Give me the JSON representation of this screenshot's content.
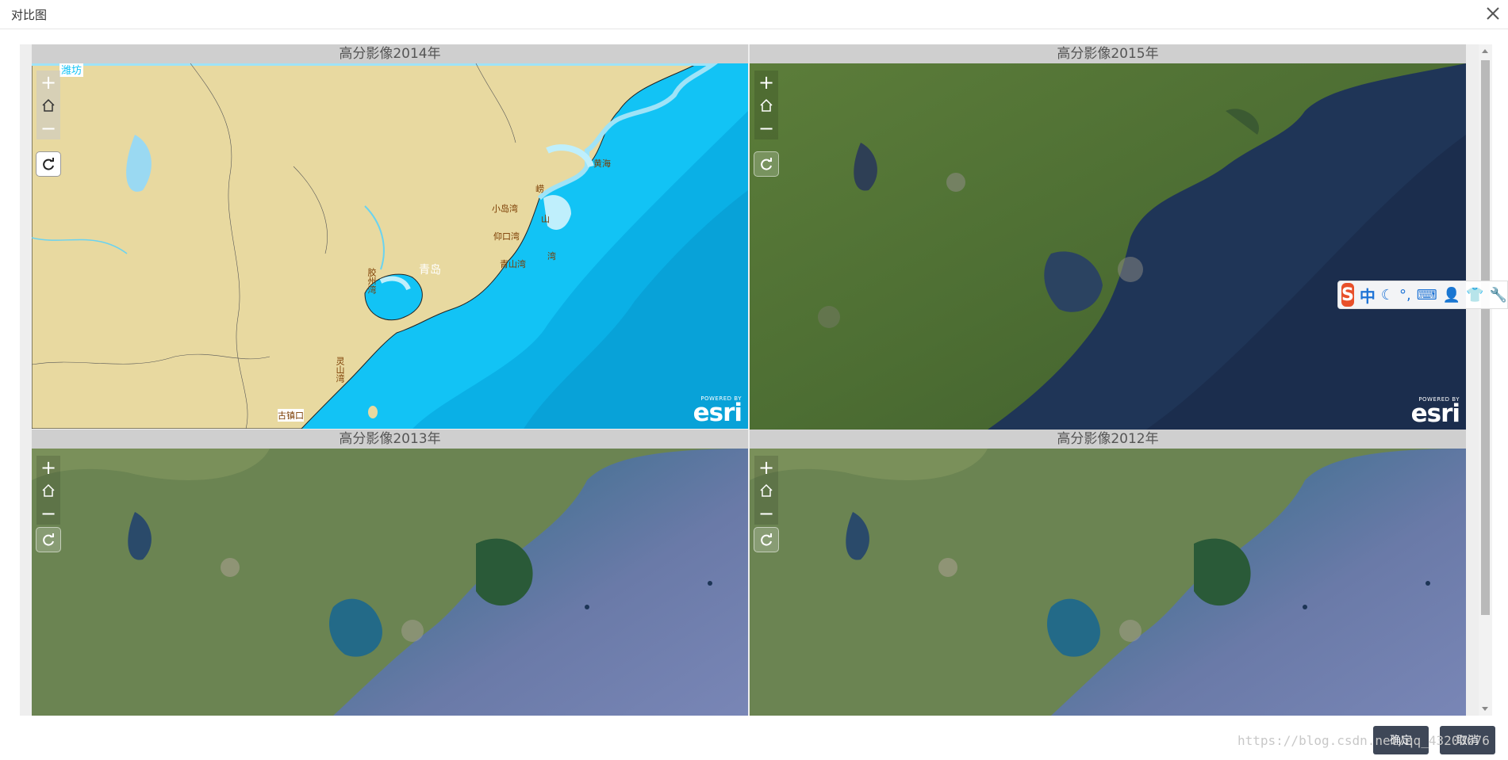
{
  "dialog": {
    "title": "对比图"
  },
  "panels": [
    {
      "title": "高分影像2014年"
    },
    {
      "title": "高分影像2015年"
    },
    {
      "title": "高分影像2013年"
    },
    {
      "title": "高分影像2012年"
    }
  ],
  "map_2014_labels": {
    "weifang": "潍坊",
    "qingdao": "青岛",
    "haiyang1": "海",
    "huanghai": "黄海",
    "chengshan": "崂",
    "bay1": "小岛湾",
    "bay2": "仰口湾",
    "bay3": "青山湾",
    "shan": "山",
    "wan": "湾",
    "jiaozhou": "胶州湾",
    "lingshan": "灵山湾",
    "guzhenkou": "古镇口"
  },
  "esri": {
    "powered_by": "POWERED BY",
    "name": "esri"
  },
  "buttons": {
    "ok": "确定",
    "cancel": "取消"
  },
  "ime": {
    "logo": "S",
    "mode": "中"
  },
  "watermark": "https://blog.csdn.net/qq_43200676"
}
